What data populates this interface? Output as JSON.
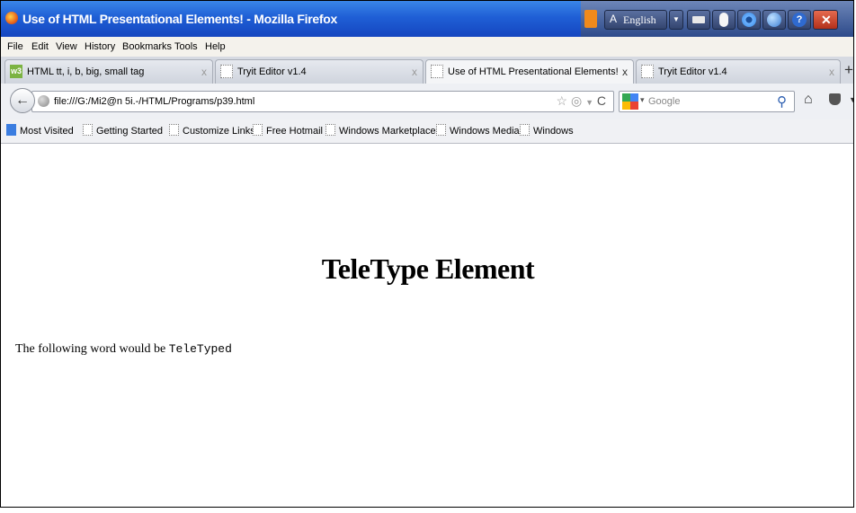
{
  "window": {
    "title": "Use of HTML Presentational Elements! - Mozilla Firefox"
  },
  "tray": {
    "language": "English"
  },
  "menu": [
    "File",
    "Edit",
    "View",
    "History",
    "Bookmarks",
    "Tools",
    "Help"
  ],
  "tabs": [
    {
      "label": "HTML tt, i, b, big, small tag",
      "close": "x"
    },
    {
      "label": "Tryit Editor v1.4",
      "close": "x"
    },
    {
      "label": "Use of HTML Presentational Elements!",
      "close": "x"
    },
    {
      "label": "Tryit Editor v1.4",
      "close": "x"
    }
  ],
  "new_tab": "+",
  "nav": {
    "url": "file:///G:/Mi2@n 5i.-/HTML/Programs/p39.html",
    "search_placeholder": "Google"
  },
  "bookmarks": [
    "Most Visited",
    "Getting Started",
    "Customize Links",
    "Free Hotmail",
    "Windows Marketplace",
    "Windows Media",
    "Windows"
  ],
  "page": {
    "heading": "TeleType Element",
    "text": "The following word would be ",
    "tt": "TeleTyped"
  }
}
